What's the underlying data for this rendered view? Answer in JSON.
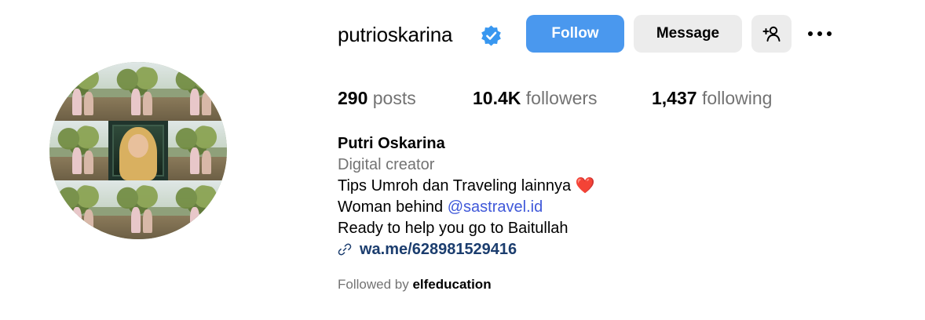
{
  "profile": {
    "username": "putrioskarina",
    "verified": true,
    "verified_icon": "verified-badge-icon",
    "avatar": "profile-photo-collage"
  },
  "actions": {
    "follow_label": "Follow",
    "message_label": "Message",
    "suggest_icon": "add-person-icon",
    "more_icon": "more-options-icon"
  },
  "stats": {
    "posts_count": "290",
    "posts_label": "posts",
    "followers_count": "10.4K",
    "followers_label": "followers",
    "following_count": "1,437",
    "following_label": "following"
  },
  "bio": {
    "full_name": "Putri Oskarina",
    "category": "Digital creator",
    "line1_text": "Tips Umroh dan Traveling lainnya",
    "line1_emoji": "❤️",
    "line2_prefix": "Woman behind",
    "line2_mention": "@sastravel.id",
    "line3": "Ready to help you go to Baitullah",
    "link_icon": "link-icon",
    "link_text": "wa.me/628981529416"
  },
  "followed_by": {
    "prefix": "Followed by",
    "user": "elfeducation"
  },
  "colors": {
    "follow_button": "#4a98ee",
    "secondary_button": "#ececec",
    "muted_text": "#737373",
    "mention": "#3f58d9",
    "link": "#1b3d6e",
    "verified": "#3897f0"
  }
}
